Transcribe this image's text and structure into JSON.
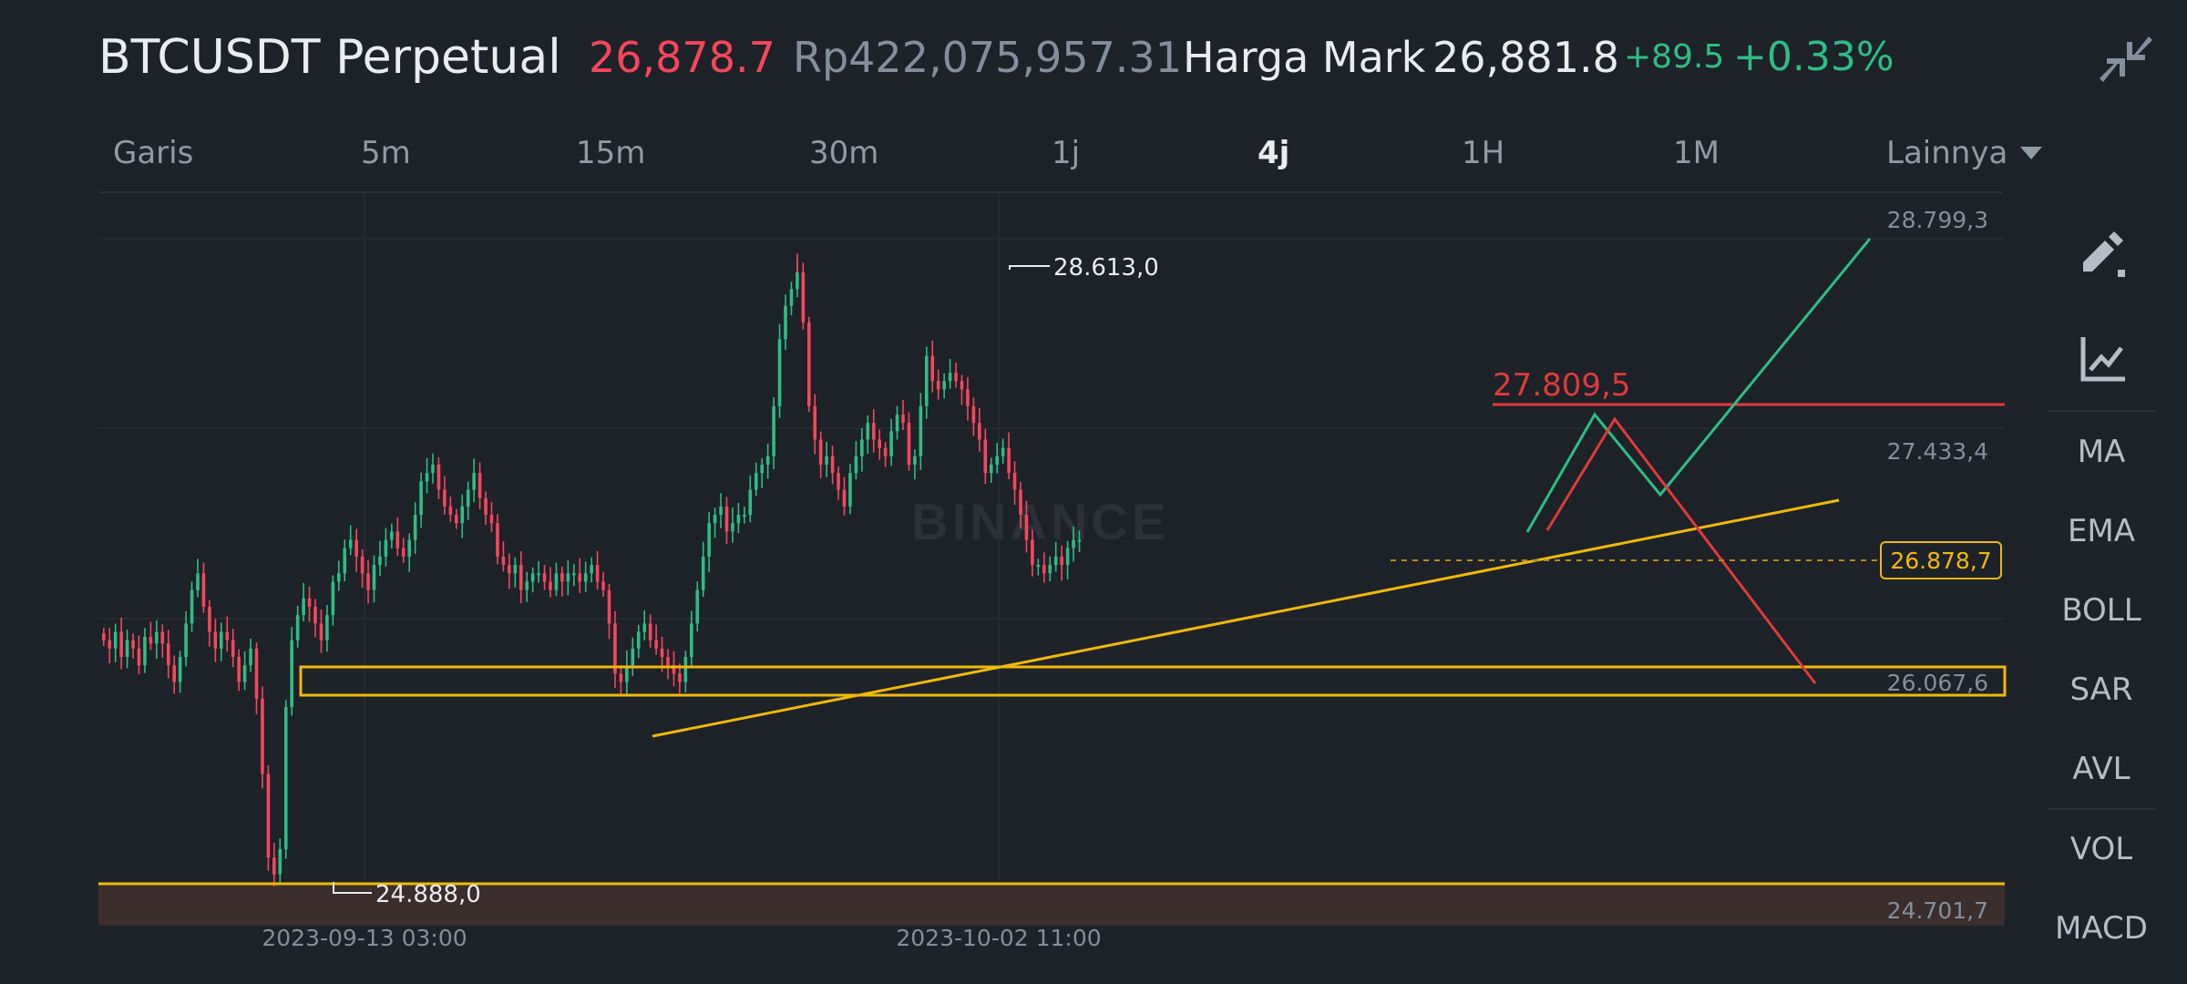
{
  "header": {
    "symbol": "BTCUSDT Perpetual",
    "last_price": "26,878.7",
    "idr_price": "Rp422,075,957.31",
    "mark_label": "Harga Mark",
    "mark_price": "26,881.8",
    "change_abs": "+89.5",
    "change_pct": "+0.33%",
    "collapse_icon": "collapse-arrows-icon"
  },
  "tabs": [
    {
      "label": "Garis",
      "active": false
    },
    {
      "label": "5m",
      "active": false
    },
    {
      "label": "15m",
      "active": false
    },
    {
      "label": "30m",
      "active": false
    },
    {
      "label": "1j",
      "active": false
    },
    {
      "label": "4j",
      "active": true
    },
    {
      "label": "1H",
      "active": false
    },
    {
      "label": "1M",
      "active": false
    },
    {
      "label": "Lainnya",
      "active": false
    }
  ],
  "chart": {
    "watermark": "BINANCE",
    "high_label": "28.613,0",
    "low_label": "24.888,0",
    "resistance_label": "27.809,5",
    "current_price_tag": "26.878,7",
    "price_axis": [
      "28.799,3",
      "27.433,4",
      "26.067,6",
      "24.701,7"
    ],
    "time_axis": [
      "2023-09-13 03:00",
      "2023-10-02 11:00"
    ],
    "colors": {
      "up": "#2ebd85",
      "down": "#f6465d",
      "drawing_yellow": "#f0b90b",
      "drawing_red": "#e03b3b",
      "drawing_green": "#2ebd85"
    }
  },
  "chart_data": {
    "type": "candlestick",
    "title": "",
    "ylim": [
      24701.7,
      28799.3
    ],
    "y_ticks": [
      28799.3,
      27433.4,
      26067.6,
      24701.7
    ],
    "x_ticks": [
      "2023-09-13 03:00",
      "2023-10-02 11:00"
    ],
    "series_close": [
      26300,
      26250,
      26350,
      26200,
      26300,
      26250,
      26150,
      26320,
      26280,
      26350,
      26280,
      26150,
      26050,
      26200,
      26400,
      26600,
      26700,
      26500,
      26350,
      26250,
      26350,
      26300,
      26200,
      26050,
      26150,
      26250,
      25950,
      25500,
      25000,
      24900,
      25050,
      25900,
      26300,
      26450,
      26550,
      26500,
      26400,
      26300,
      26450,
      26650,
      26700,
      26850,
      26900,
      26800,
      26700,
      26600,
      26750,
      26800,
      26900,
      26950,
      26850,
      26800,
      26900,
      27050,
      27250,
      27300,
      27350,
      27200,
      27100,
      27050,
      27000,
      27100,
      27200,
      27300,
      27150,
      27050,
      27000,
      26800,
      26750,
      26700,
      26750,
      26600,
      26650,
      26700,
      26700,
      26650,
      26600,
      26700,
      26650,
      26700,
      26700,
      26650,
      26700,
      26750,
      26650,
      26600,
      26400,
      26100,
      26050,
      26150,
      26250,
      26350,
      26400,
      26300,
      26250,
      26200,
      26150,
      26100,
      26050,
      26200,
      26400,
      26600,
      26800,
      27000,
      27050,
      27100,
      26950,
      27000,
      27050,
      27050,
      27200,
      27300,
      27350,
      27400,
      27700,
      28100,
      28300,
      28400,
      28500,
      28200,
      27700,
      27500,
      27350,
      27400,
      27300,
      27200,
      27100,
      27300,
      27400,
      27500,
      27600,
      27500,
      27450,
      27400,
      27550,
      27650,
      27600,
      27350,
      27400,
      27700,
      28000,
      27850,
      27800,
      27850,
      27900,
      27850,
      27800,
      27700,
      27600,
      27500,
      27300,
      27350,
      27400,
      27450,
      27300,
      27200,
      27050,
      26900,
      26750,
      26750,
      26700,
      26750,
      26800,
      26750,
      26850,
      26900,
      26900
    ],
    "high_point": 28613.0,
    "low_point": 24888.0,
    "last_price": 26878.7,
    "horizontal_levels": [
      {
        "value": 27809.5,
        "color": "red",
        "label": "27.809,5"
      },
      {
        "value": 26067.6,
        "color": "yellow",
        "note": "zone"
      },
      {
        "value": 24701.7,
        "color": "yellow",
        "note": "bottom support"
      }
    ]
  },
  "sidebar": {
    "tools": [
      {
        "icon": "pencil-draw-icon"
      },
      {
        "icon": "indicator-chart-icon"
      }
    ],
    "main_indicators": [
      "MA",
      "EMA",
      "BOLL",
      "SAR",
      "AVL"
    ],
    "sub_indicators": [
      "VOL",
      "MACD"
    ]
  }
}
